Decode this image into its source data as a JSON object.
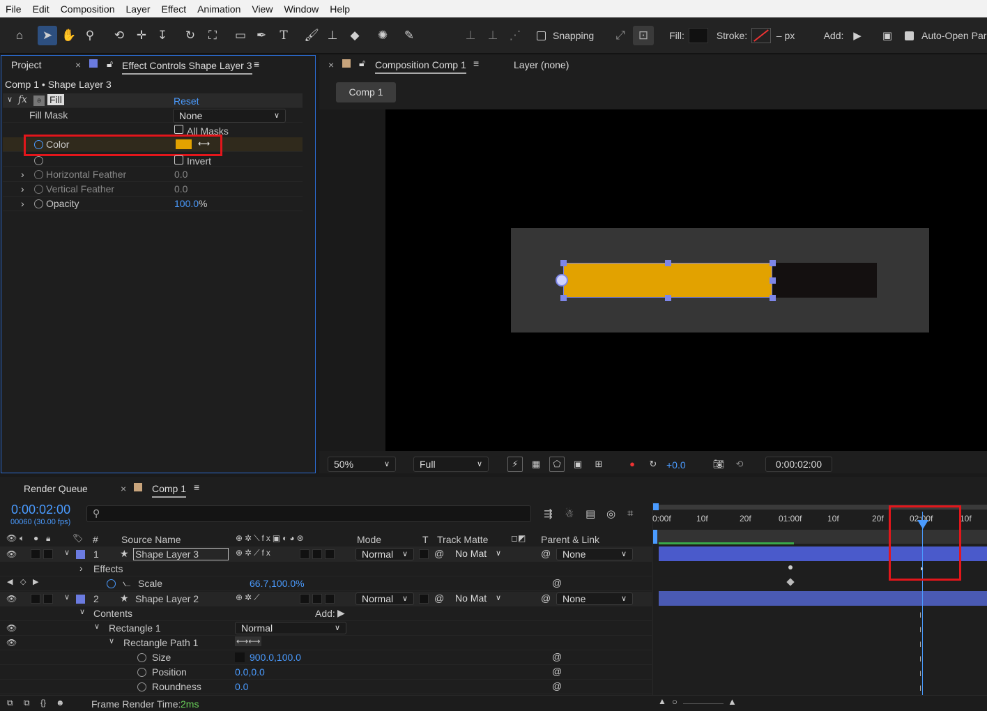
{
  "menu": [
    "File",
    "Edit",
    "Composition",
    "Layer",
    "Effect",
    "Animation",
    "View",
    "Window",
    "Help"
  ],
  "toolbar": {
    "snapping_label": "Snapping",
    "fill_label": "Fill:",
    "stroke_label": "Stroke:",
    "stroke_units": "– px",
    "add_label": "Add:",
    "auto_open_label": "Auto-Open Par"
  },
  "project_panel": {
    "tab_project": "Project",
    "tab_effect_controls": "Effect Controls Shape Layer 3",
    "breadcrumb": "Comp 1 • Shape Layer 3",
    "effect_name": "Fill",
    "reset_label": "Reset",
    "fill_mask_label": "Fill Mask",
    "fill_mask_value": "None",
    "all_masks_label": "All Masks",
    "color_label": "Color",
    "color_value": "#e2a200",
    "invert_label": "Invert",
    "horizontal_feather_label": "Horizontal Feather",
    "horizontal_feather_value": "0.0",
    "vertical_feather_label": "Vertical Feather",
    "vertical_feather_value": "0.0",
    "opacity_label": "Opacity",
    "opacity_value": "100.0",
    "opacity_unit": "%"
  },
  "composition_panel": {
    "tab_label": "Composition Comp 1",
    "layer_tab": "Layer (none)",
    "comp_button": "Comp 1",
    "zoom_value": "50%",
    "resolution_value": "Full",
    "exposure_value": "+0.0",
    "timecode": "0:00:02:00",
    "bar_color": "#e2a200"
  },
  "timeline": {
    "tab_render_queue": "Render Queue",
    "tab_comp": "Comp 1",
    "current_time": "0:00:02:00",
    "frame_info": "00060 (30.00 fps)",
    "search_placeholder": "",
    "col_num": "#",
    "col_source_name": "Source Name",
    "col_mode": "Mode",
    "col_t": "T",
    "col_track_matte": "Track Matte",
    "col_parent": "Parent & Link",
    "ruler_labels": [
      "0:00f",
      "10f",
      "20f",
      "01:00f",
      "10f",
      "20f",
      "02:00f",
      "10f"
    ],
    "layers": [
      {
        "index": "1",
        "name": "Shape Layer 3",
        "mode": "Normal",
        "matte": "No Mat",
        "parent": "None"
      },
      {
        "index": "2",
        "name": "Shape Layer 2",
        "mode": "Normal",
        "matte": "No Mat",
        "parent": "None"
      }
    ],
    "effects_label": "Effects",
    "scale_label": "Scale",
    "scale_value": "66.7,100.0%",
    "contents_label": "Contents",
    "add_label": "Add:",
    "rectangle_label": "Rectangle 1",
    "rectangle_mode": "Normal",
    "rect_path_label": "Rectangle Path 1",
    "size_label": "Size",
    "size_value": "900.0,100.0",
    "position_label": "Position",
    "position_value": "0.0,0.0",
    "roundness_label": "Roundness",
    "roundness_value": "0.0",
    "frame_render_label": "Frame Render Time:",
    "frame_render_value": "2ms"
  }
}
